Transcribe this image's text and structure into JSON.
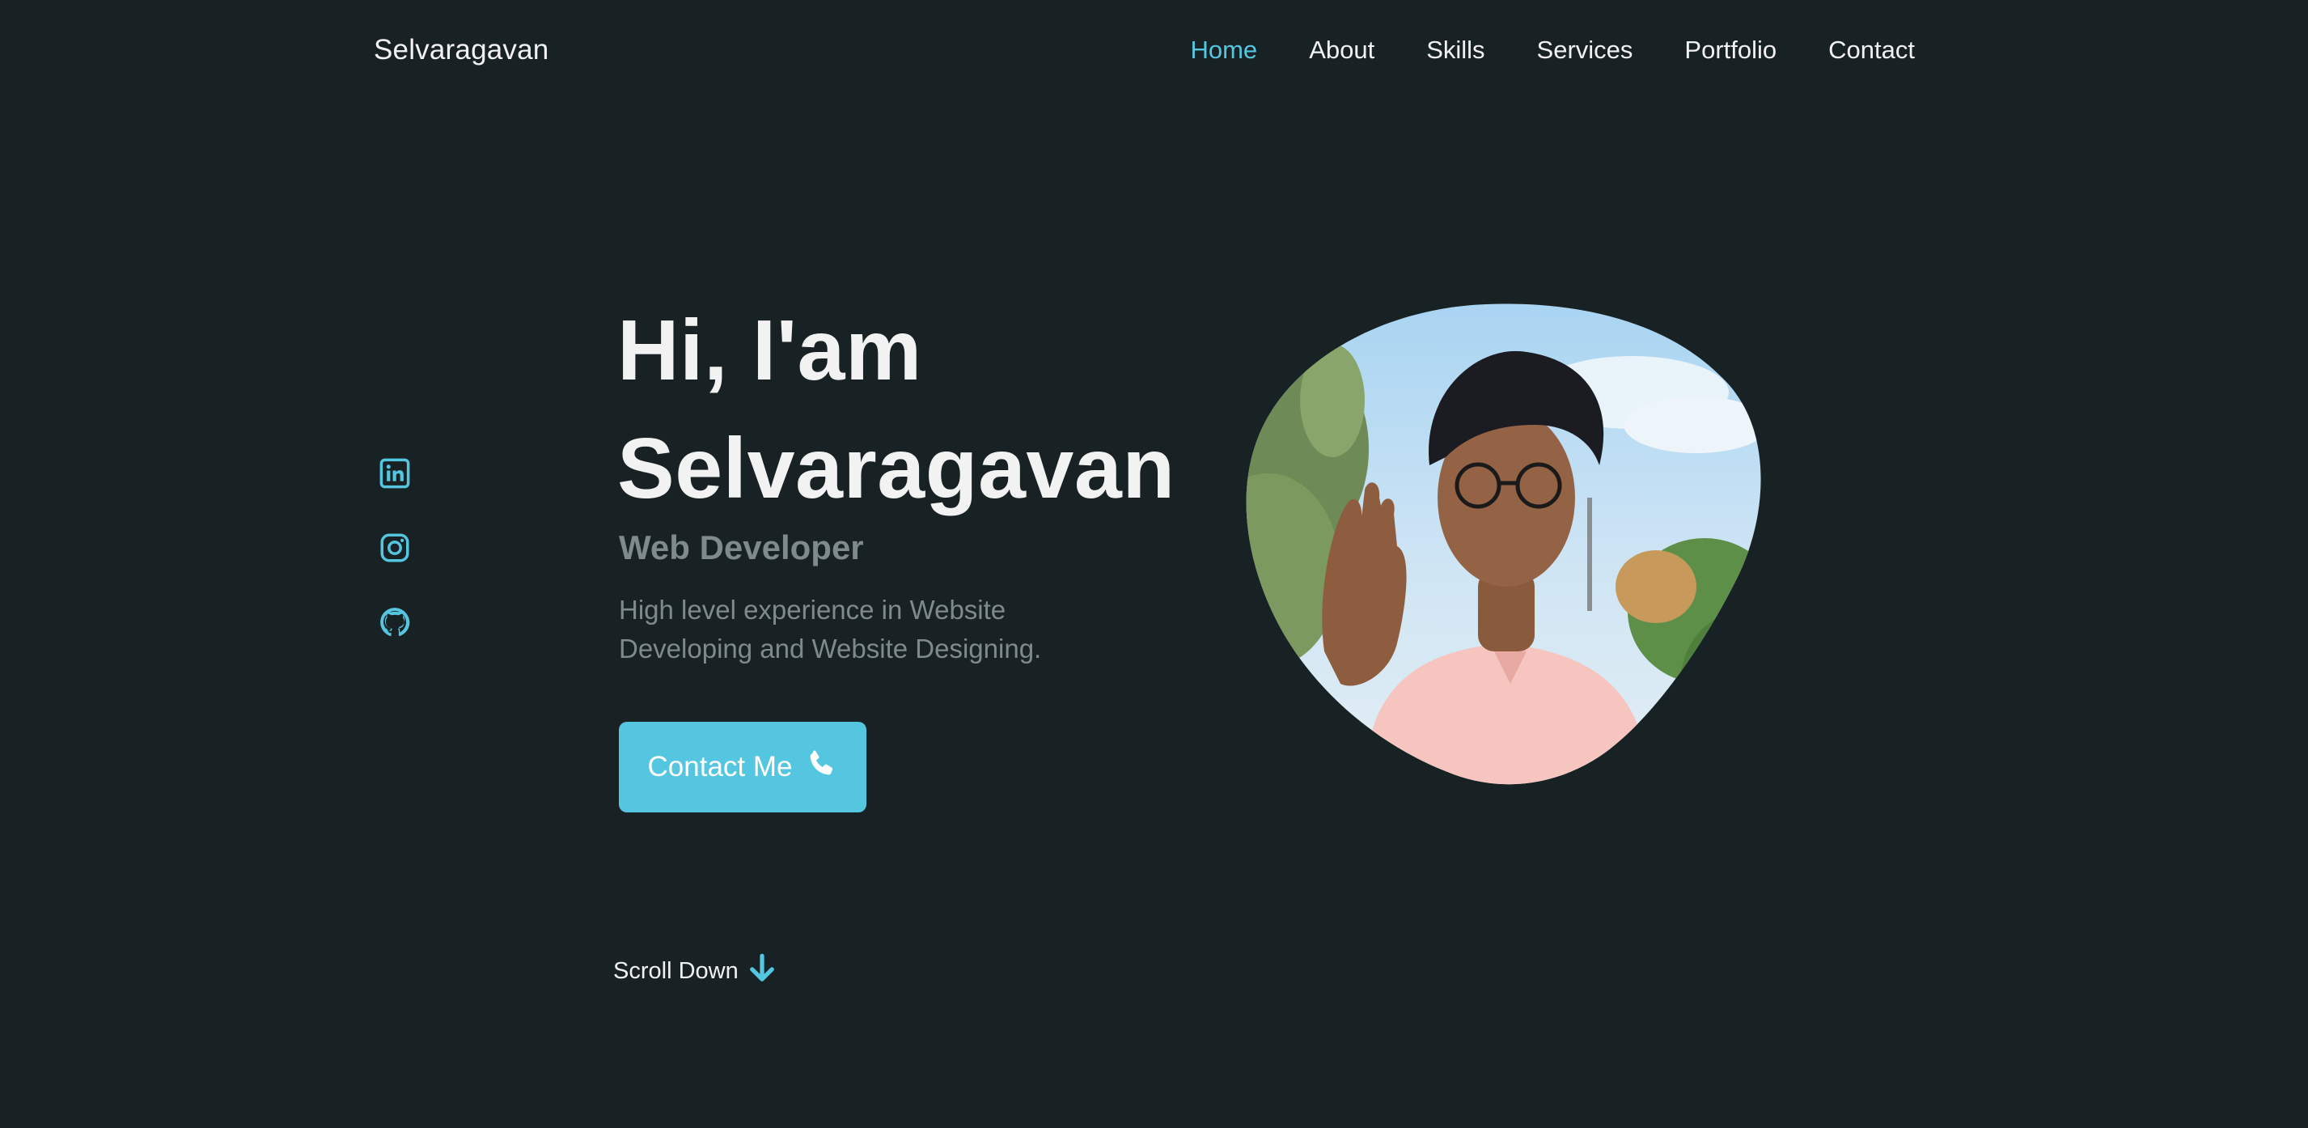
{
  "header": {
    "logo": "Selvaragavan",
    "nav": [
      {
        "label": "Home",
        "active": true
      },
      {
        "label": "About",
        "active": false
      },
      {
        "label": "Skills",
        "active": false
      },
      {
        "label": "Services",
        "active": false
      },
      {
        "label": "Portfolio",
        "active": false
      },
      {
        "label": "Contact",
        "active": false
      }
    ]
  },
  "social": [
    {
      "icon": "linkedin-icon"
    },
    {
      "icon": "instagram-icon"
    },
    {
      "icon": "github-icon"
    }
  ],
  "hero": {
    "greeting": "Hi, I'am",
    "name": "Selvaragavan",
    "subtitle": "Web Developer",
    "description": "High level experience in Website Developing and Website Designing.",
    "button_label": "Contact Me",
    "button_icon": "phone-icon"
  },
  "scroll": {
    "label": "Scroll Down",
    "icon": "arrow-down-icon"
  },
  "colors": {
    "background": "#182124",
    "accent": "#55c6e0",
    "text": "#f2f2f2",
    "muted": "#7f8a8c"
  }
}
